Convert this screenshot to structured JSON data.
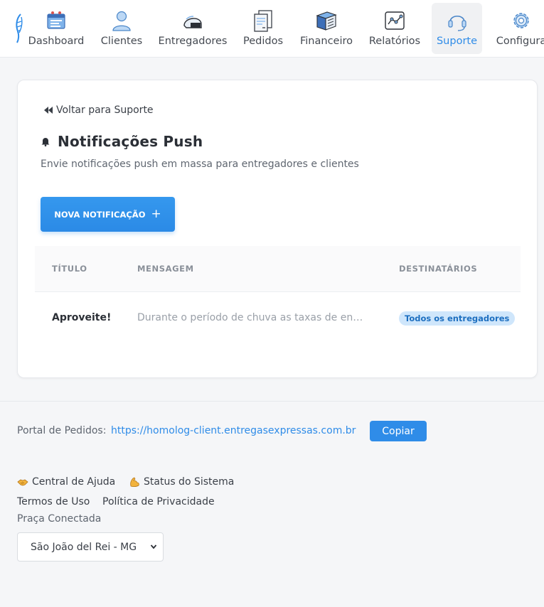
{
  "nav": {
    "items": [
      {
        "label": "Dashboard",
        "icon": "dashboard-icon"
      },
      {
        "label": "Clientes",
        "icon": "user-icon"
      },
      {
        "label": "Entregadores",
        "icon": "helmet-icon"
      },
      {
        "label": "Pedidos",
        "icon": "receipt-icon"
      },
      {
        "label": "Financeiro",
        "icon": "books-icon"
      },
      {
        "label": "Relatórios",
        "icon": "chart-icon"
      },
      {
        "label": "Suporte",
        "icon": "headset-icon",
        "active": true
      },
      {
        "label": "Configura",
        "icon": "gear-icon"
      }
    ]
  },
  "page": {
    "back_label": "Voltar para Suporte",
    "title": "Notificações Push",
    "subtitle": "Envie notificações push em massa para entregadores e clientes",
    "new_button": "NOVA NOTIFICAÇÃO",
    "table": {
      "headers": [
        "TÍTULO",
        "MENSAGEM",
        "DESTINATÁRIOS"
      ],
      "rows": [
        {
          "title": "Aproveite!",
          "message": "Durante o período de chuva as taxas de ent…",
          "recipients": "Todos os entregadores"
        }
      ]
    }
  },
  "footer": {
    "portal_label": "Portal de Pedidos:",
    "portal_url": "https://homolog-client.entregasexpressas.com.br",
    "copy_button": "Copiar",
    "links": {
      "help": "Central de Ajuda",
      "status": "Status do Sistema",
      "terms": "Termos de Uso",
      "privacy": "Política de Privacidade"
    },
    "praca_label": "Praça Conectada",
    "praca_selected": "São João del Rei - MG"
  },
  "colors": {
    "accent": "#2f8ce8",
    "badge_bg": "#cfe6fb",
    "badge_text": "#1d6fc0"
  }
}
